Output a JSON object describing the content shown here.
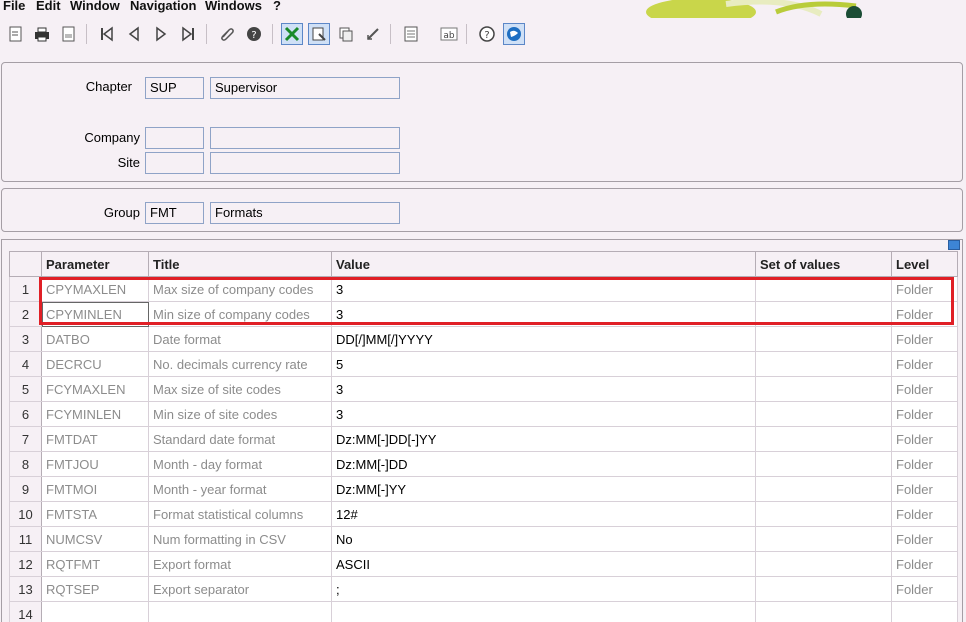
{
  "menu": [
    "File",
    "Edit",
    "Window",
    "Navigation",
    "Windows",
    "?"
  ],
  "toolbar": {
    "icons": [
      "new-doc-icon",
      "print-icon",
      "print-preview-icon",
      "first-record-icon",
      "previous-record-icon",
      "next-record-icon",
      "last-record-icon",
      "attach-icon",
      "help-circle-icon",
      "selection-icon",
      "window-list-icon",
      "copy-window-icon",
      "refresh-icon",
      "list-icon",
      "text-field-icon",
      "question-icon",
      "globe-icon"
    ]
  },
  "header": {
    "chapter_label": "Chapter",
    "chapter_code": "SUP",
    "chapter_name": "Supervisor",
    "company_label": "Company",
    "company_code": "",
    "company_name": "",
    "site_label": "Site",
    "site_code": "",
    "site_name": ""
  },
  "group": {
    "label": "Group",
    "code": "FMT",
    "name": "Formats"
  },
  "grid": {
    "columns": [
      "Parameter",
      "Title",
      "Value",
      "Set of values",
      "Level"
    ],
    "rows": [
      {
        "num": "1",
        "parameter": "CPYMAXLEN",
        "title": "Max size of company codes",
        "value": "3",
        "set": "",
        "level": "Folder"
      },
      {
        "num": "2",
        "parameter": "CPYMINLEN",
        "title": "Min size of company codes",
        "value": "3",
        "set": "",
        "level": "Folder"
      },
      {
        "num": "3",
        "parameter": "DATBO",
        "title": "Date format",
        "value": "DD[/]MM[/]YYYY",
        "set": "",
        "level": "Folder"
      },
      {
        "num": "4",
        "parameter": "DECRCU",
        "title": "No. decimals currency rate",
        "value": "5",
        "set": "",
        "level": "Folder"
      },
      {
        "num": "5",
        "parameter": "FCYMAXLEN",
        "title": "Max size of site codes",
        "value": "3",
        "set": "",
        "level": "Folder"
      },
      {
        "num": "6",
        "parameter": "FCYMINLEN",
        "title": "Min size of site codes",
        "value": "3",
        "set": "",
        "level": "Folder"
      },
      {
        "num": "7",
        "parameter": "FMTDAT",
        "title": "Standard date format",
        "value": "Dz:MM[-]DD[-]YY",
        "set": "",
        "level": "Folder"
      },
      {
        "num": "8",
        "parameter": "FMTJOU",
        "title": "Month - day format",
        "value": "Dz:MM[-]DD",
        "set": "",
        "level": "Folder"
      },
      {
        "num": "9",
        "parameter": "FMTMOI",
        "title": "Month - year format",
        "value": "Dz:MM[-]YY",
        "set": "",
        "level": "Folder"
      },
      {
        "num": "10",
        "parameter": "FMTSTA",
        "title": "Format statistical columns",
        "value": "12#",
        "set": "",
        "level": "Folder"
      },
      {
        "num": "11",
        "parameter": "NUMCSV",
        "title": "Num formatting in CSV",
        "value": "No",
        "set": "",
        "level": "Folder"
      },
      {
        "num": "12",
        "parameter": "RQTFMT",
        "title": "Export format",
        "value": "ASCII",
        "set": "",
        "level": "Folder"
      },
      {
        "num": "13",
        "parameter": "RQTSEP",
        "title": "Export separator",
        "value": ";",
        "set": "",
        "level": "Folder"
      },
      {
        "num": "14",
        "parameter": "",
        "title": "",
        "value": "",
        "set": "",
        "level": ""
      }
    ]
  },
  "colors": {
    "background": "#f6f0f5",
    "highlight": "#e01f26",
    "field_border": "#8fa3c7"
  }
}
